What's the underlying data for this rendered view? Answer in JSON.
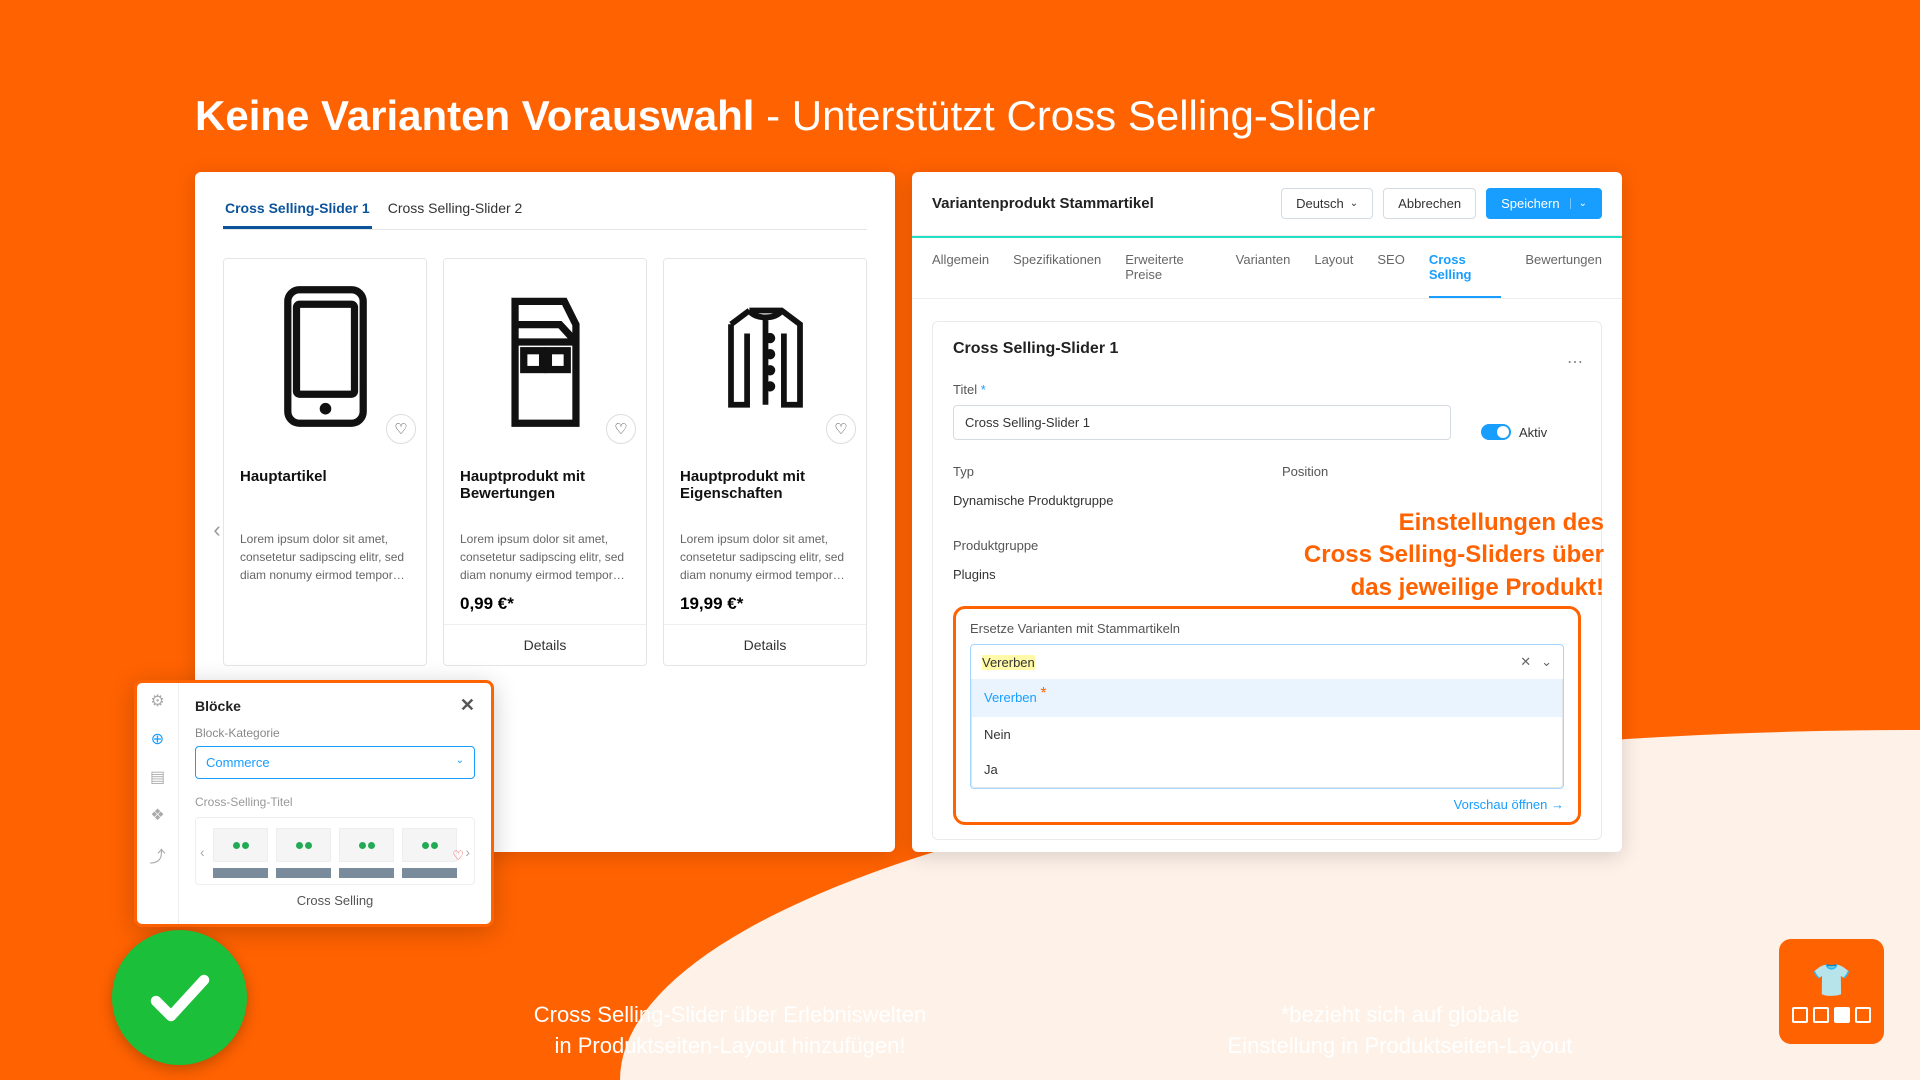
{
  "heading_bold": "Keine Varianten Vorauswahl",
  "heading_rest": " - Unterstützt Cross Selling-Slider",
  "left": {
    "tabs": [
      "Cross Selling-Slider 1",
      "Cross Selling-Slider 2"
    ],
    "products": [
      {
        "title": "Hauptartikel",
        "desc": "Lorem ipsum dolor sit amet, consetetur sadipscing elitr, sed diam nonumy eirmod tempor…",
        "price": ""
      },
      {
        "title": "Hauptprodukt mit Bewertungen",
        "desc": "Lorem ipsum dolor sit amet, consetetur sadipscing elitr, sed diam nonumy eirmod tempor…",
        "price": "0,99 €*"
      },
      {
        "title": "Hauptprodukt mit Eigenschaften",
        "desc": "Lorem ipsum dolor sit amet, consetetur sadipscing elitr, sed diam nonumy eirmod tempor…",
        "price": "19,99 €*"
      }
    ],
    "details": "Details"
  },
  "blocks": {
    "title": "Blöcke",
    "cat_label": "Block-Kategorie",
    "cat_value": "Commerce",
    "subtitle": "Cross-Selling-Titel",
    "item": "Cross Selling"
  },
  "right": {
    "title": "Variantenprodukt Stammartikel",
    "lang": "Deutsch",
    "cancel": "Abbrechen",
    "save": "Speichern",
    "tabs": [
      "Allgemein",
      "Spezifikationen",
      "Erweiterte Preise",
      "Varianten",
      "Layout",
      "SEO",
      "Cross Selling",
      "Bewertungen"
    ],
    "card_title": "Cross Selling-Slider 1",
    "f_title_lbl": "Titel",
    "f_title_val": "Cross Selling-Slider 1",
    "active": "Aktiv",
    "type_lbl": "Typ",
    "type_val": "Dynamische Produktgruppe",
    "pos_lbl": "Position",
    "grp_lbl": "Produktgruppe",
    "grp_val": "Plugins",
    "rep_lbl": "Ersetze Varianten mit Stammartikeln",
    "rep_val": "Vererben",
    "options": [
      "Vererben",
      "Nein",
      "Ja"
    ],
    "preview": "Vorschau öffnen →"
  },
  "annot": {
    "l1": "Einstellungen des",
    "l2": "Cross Selling-Sliders über",
    "l3": "das jeweilige Produkt!"
  },
  "cap1_l1": "Cross Selling-Slider über Erlebniswelten",
  "cap1_l2": "in Produktseiten-Layout hinzufügen!",
  "cap2_l1": "*bezieht sich auf globale",
  "cap2_l2": "Einstellung in Produktseiten-Layout"
}
